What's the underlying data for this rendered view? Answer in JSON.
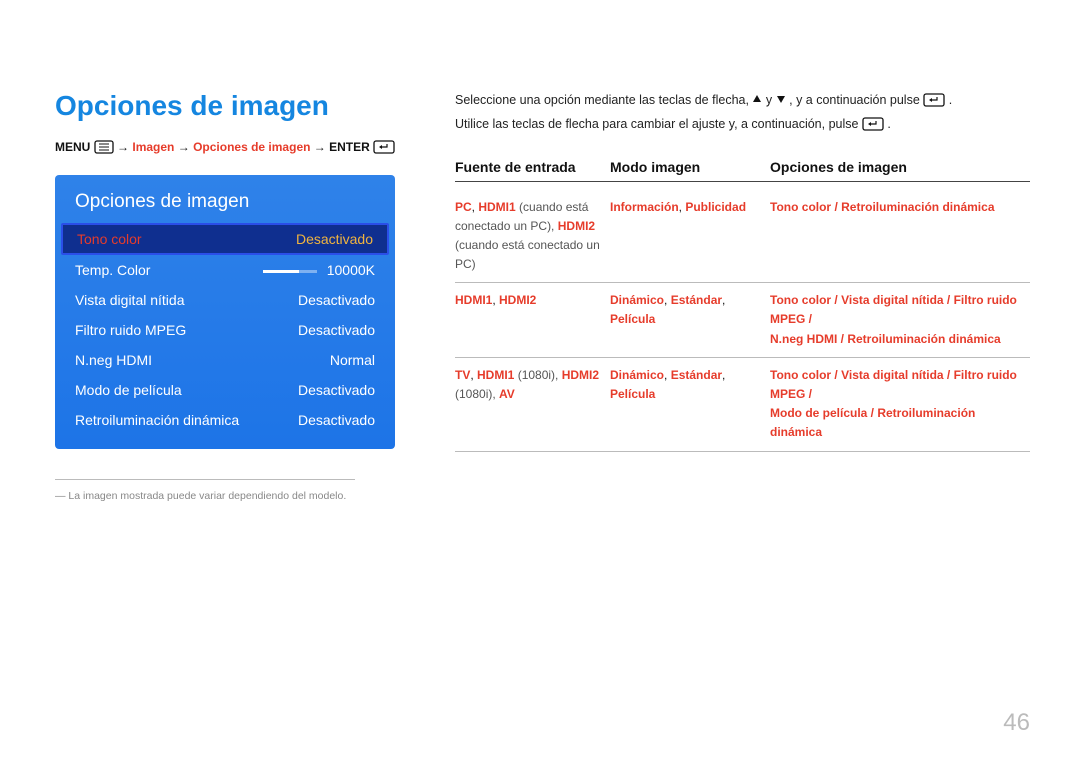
{
  "title": "Opciones de imagen",
  "breadcrumb": {
    "menu": "MENU",
    "arrow": " → ",
    "imagen": "Imagen",
    "opciones": "Opciones de imagen",
    "enter": "ENTER"
  },
  "panel": {
    "title": "Opciones de imagen",
    "rows": [
      {
        "label": "Tono color",
        "value": "Desactivado",
        "selected": true
      },
      {
        "label": "Temp. Color",
        "value": "10000K",
        "slider": true
      },
      {
        "label": "Vista digital nítida",
        "value": "Desactivado"
      },
      {
        "label": "Filtro ruido MPEG",
        "value": "Desactivado"
      },
      {
        "label": "N.neg HDMI",
        "value": "Normal"
      },
      {
        "label": "Modo de película",
        "value": "Desactivado"
      },
      {
        "label": "Retroiluminación dinámica",
        "value": "Desactivado"
      }
    ]
  },
  "footnote": "― La imagen mostrada puede variar dependiendo del modelo.",
  "intro": {
    "l1a": "Seleccione una opción mediante las teclas de flecha, ",
    "l1b": " y ",
    "l1c": ", y a continuación pulse ",
    "l1d": ".",
    "l2a": "Utilice las teclas de flecha para cambiar el ajuste y, a continuación, pulse ",
    "l2b": "."
  },
  "table": {
    "headers": {
      "c1": "Fuente de entrada",
      "c2": "Modo imagen",
      "c3": "Opciones de imagen"
    },
    "rows": [
      {
        "c1_red1": "PC",
        "c1_sep1": ", ",
        "c1_red2": "HDMI1",
        "c1_gray1": " (cuando está conectado un PC), ",
        "c1_red3": "HDMI2",
        "c1_gray2": " (cuando está conectado un PC)",
        "c2_red": "Información",
        "c2_sep": ", ",
        "c2_red2": "Publicidad",
        "c3_red": "Tono color",
        "c3_sep": " / ",
        "c3_red2": "Retroiluminación dinámica"
      },
      {
        "c1_red1": "HDMI1",
        "c1_sep1": ", ",
        "c1_red2": "HDMI2",
        "c2_red": "Dinámico",
        "c2_sep": ", ",
        "c2_red2": "Estándar",
        "c2_sep2": ", ",
        "c2_red3": "Película",
        "c3_line1": "Tono color / Vista digital nítida / Filtro ruido MPEG /",
        "c3_line2": "N.neg HDMI / Retroiluminación dinámica"
      },
      {
        "c1_red1": "TV",
        "c1_sep1": ", ",
        "c1_red2": "HDMI1",
        "c1_gray1": " (1080i), ",
        "c1_red3": "HDMI2",
        "c1_gray2": " (1080i), ",
        "c1_red4": "AV",
        "c2_red": "Dinámico",
        "c2_sep": ", ",
        "c2_red2": "Estándar",
        "c2_sep2": ", ",
        "c2_red3": "Película",
        "c3_line1": "Tono color / Vista digital nítida / Filtro ruido MPEG /",
        "c3_line2": "Modo de película / Retroiluminación dinámica"
      }
    ]
  },
  "pagenum": "46"
}
